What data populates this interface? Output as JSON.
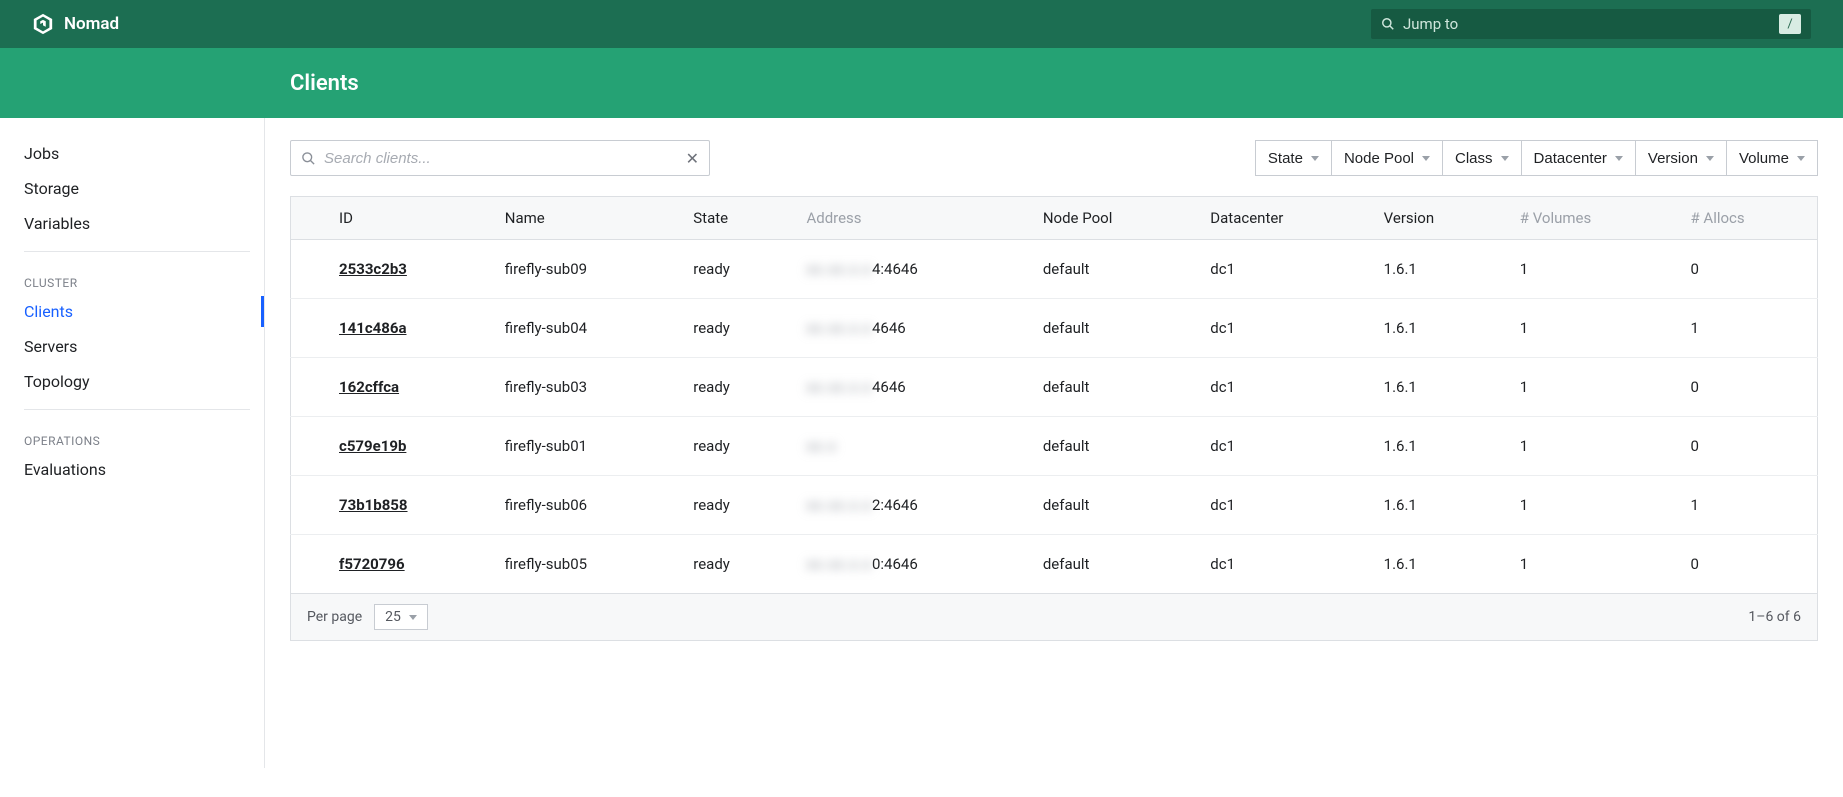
{
  "brand": {
    "name": "Nomad"
  },
  "jumpto": {
    "placeholder": "Jump to",
    "shortcut": "/"
  },
  "page_title": "Clients",
  "sidebar": {
    "workloads": [
      {
        "label": "Jobs"
      },
      {
        "label": "Storage"
      },
      {
        "label": "Variables"
      }
    ],
    "cluster_label": "CLUSTER",
    "cluster": [
      {
        "label": "Clients",
        "active": true
      },
      {
        "label": "Servers"
      },
      {
        "label": "Topology"
      }
    ],
    "operations_label": "OPERATIONS",
    "operations": [
      {
        "label": "Evaluations"
      }
    ]
  },
  "search": {
    "placeholder": "Search clients..."
  },
  "filters": [
    {
      "label": "State"
    },
    {
      "label": "Node Pool"
    },
    {
      "label": "Class"
    },
    {
      "label": "Datacenter"
    },
    {
      "label": "Version"
    },
    {
      "label": "Volume"
    }
  ],
  "columns": {
    "id": "ID",
    "name": "Name",
    "state": "State",
    "address": "Address",
    "node_pool": "Node Pool",
    "datacenter": "Datacenter",
    "version": "Version",
    "volumes": "# Volumes",
    "allocs": "# Allocs"
  },
  "rows": [
    {
      "id": "2533c2b3",
      "name": "firefly-sub09",
      "state": "ready",
      "addr_hidden": "xx.xx.x.x",
      "addr_suffix": "4:4646",
      "node_pool": "default",
      "dc": "dc1",
      "version": "1.6.1",
      "volumes": "1",
      "allocs": "0"
    },
    {
      "id": "141c486a",
      "name": "firefly-sub04",
      "state": "ready",
      "addr_hidden": "xx.xx.x.x",
      "addr_suffix": "4646",
      "node_pool": "default",
      "dc": "dc1",
      "version": "1.6.1",
      "volumes": "1",
      "allocs": "1"
    },
    {
      "id": "162cffca",
      "name": "firefly-sub03",
      "state": "ready",
      "addr_hidden": "xx.xx.x.x",
      "addr_suffix": "4646",
      "node_pool": "default",
      "dc": "dc1",
      "version": "1.6.1",
      "volumes": "1",
      "allocs": "0"
    },
    {
      "id": "c579e19b",
      "name": "firefly-sub01",
      "state": "ready",
      "addr_hidden": "xx.x",
      "addr_suffix": "",
      "node_pool": "default",
      "dc": "dc1",
      "version": "1.6.1",
      "volumes": "1",
      "allocs": "0"
    },
    {
      "id": "73b1b858",
      "name": "firefly-sub06",
      "state": "ready",
      "addr_hidden": "xx.xx.x.x",
      "addr_suffix": "2:4646",
      "node_pool": "default",
      "dc": "dc1",
      "version": "1.6.1",
      "volumes": "1",
      "allocs": "1"
    },
    {
      "id": "f5720796",
      "name": "firefly-sub05",
      "state": "ready",
      "addr_hidden": "xx.xx.x.x",
      "addr_suffix": "0:4646",
      "node_pool": "default",
      "dc": "dc1",
      "version": "1.6.1",
      "volumes": "1",
      "allocs": "0"
    }
  ],
  "pagination": {
    "per_page_label": "Per page",
    "per_page_value": "25",
    "range": "1–6 of 6"
  }
}
